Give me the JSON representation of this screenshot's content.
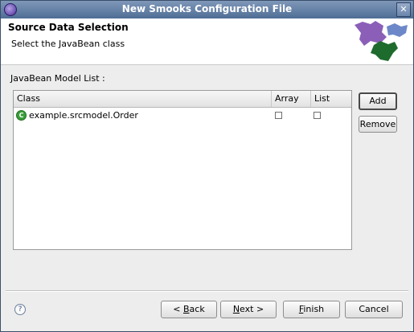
{
  "window": {
    "title": "New Smooks Configuration File",
    "close_glyph": "✕"
  },
  "banner": {
    "heading": "Source Data Selection",
    "description": "Select the JavaBean class"
  },
  "model_list": {
    "label": "JavaBean Model List :",
    "columns": [
      "Class",
      "Array",
      "List"
    ],
    "rows": [
      {
        "class": "example.srcmodel.Order",
        "array": false,
        "list": false,
        "icon": "class-icon"
      }
    ]
  },
  "side_buttons": {
    "add": "Add",
    "remove": "Remove"
  },
  "footer": {
    "help_glyph": "?",
    "back_pre": "< ",
    "back_key": "B",
    "back_post": "ack",
    "next_key": "N",
    "next_post": "ext >",
    "finish_key": "F",
    "finish_post": "inish",
    "cancel": "Cancel"
  },
  "colors": {
    "title_bar": "#5b78a0",
    "dialog_bg": "#ededed",
    "purple_shape": "#8b5fb8",
    "blue_shape": "#6d88c8",
    "green_shape": "#1e6b2e"
  }
}
